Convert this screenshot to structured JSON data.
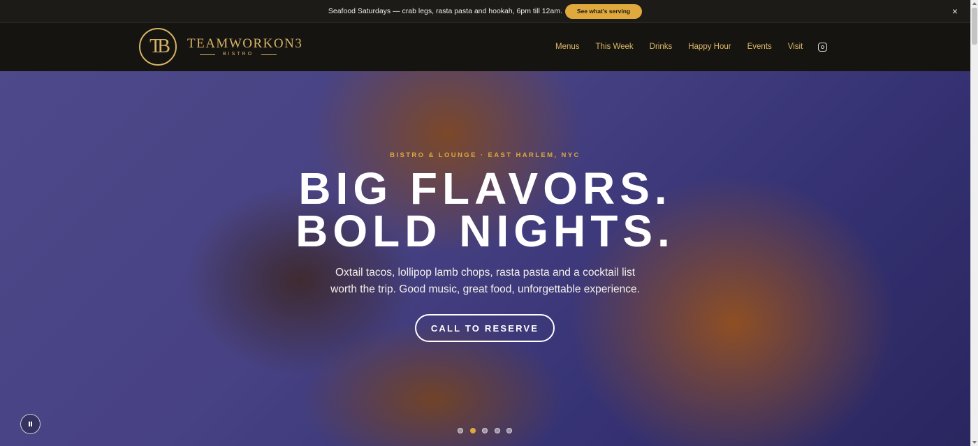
{
  "announcement": {
    "message": "Seafood Saturdays — crab legs, rasta pasta and hookah, 6pm till 12am.",
    "button_label": "See what's serving",
    "close_glyph": "×",
    "accent_color": "#e0a93e"
  },
  "brand": {
    "monogram": "TB",
    "name": "TEAMWORKON3",
    "subtitle": "BISTRO",
    "color": "#d6b366"
  },
  "nav": {
    "items": [
      "Menus",
      "This Week",
      "Drinks",
      "Happy Hour",
      "Events",
      "Visit"
    ],
    "social_icon": "instagram-icon"
  },
  "hero": {
    "eyebrow": "BISTRO & LOUNGE · EAST HARLEM, NYC",
    "headline_line1": "BIG FLAVORS.",
    "headline_line2": "BOLD NIGHTS.",
    "sub_line1": "Oxtail tacos, lollipop lamb chops, rasta pasta and a cocktail list",
    "sub_line2": "worth the trip. Good music, great food, unforgettable experience.",
    "cta_label": "CALL TO RESERVE",
    "slide_count": 5,
    "active_slide": 2,
    "pause_icon": "pause-icon"
  }
}
